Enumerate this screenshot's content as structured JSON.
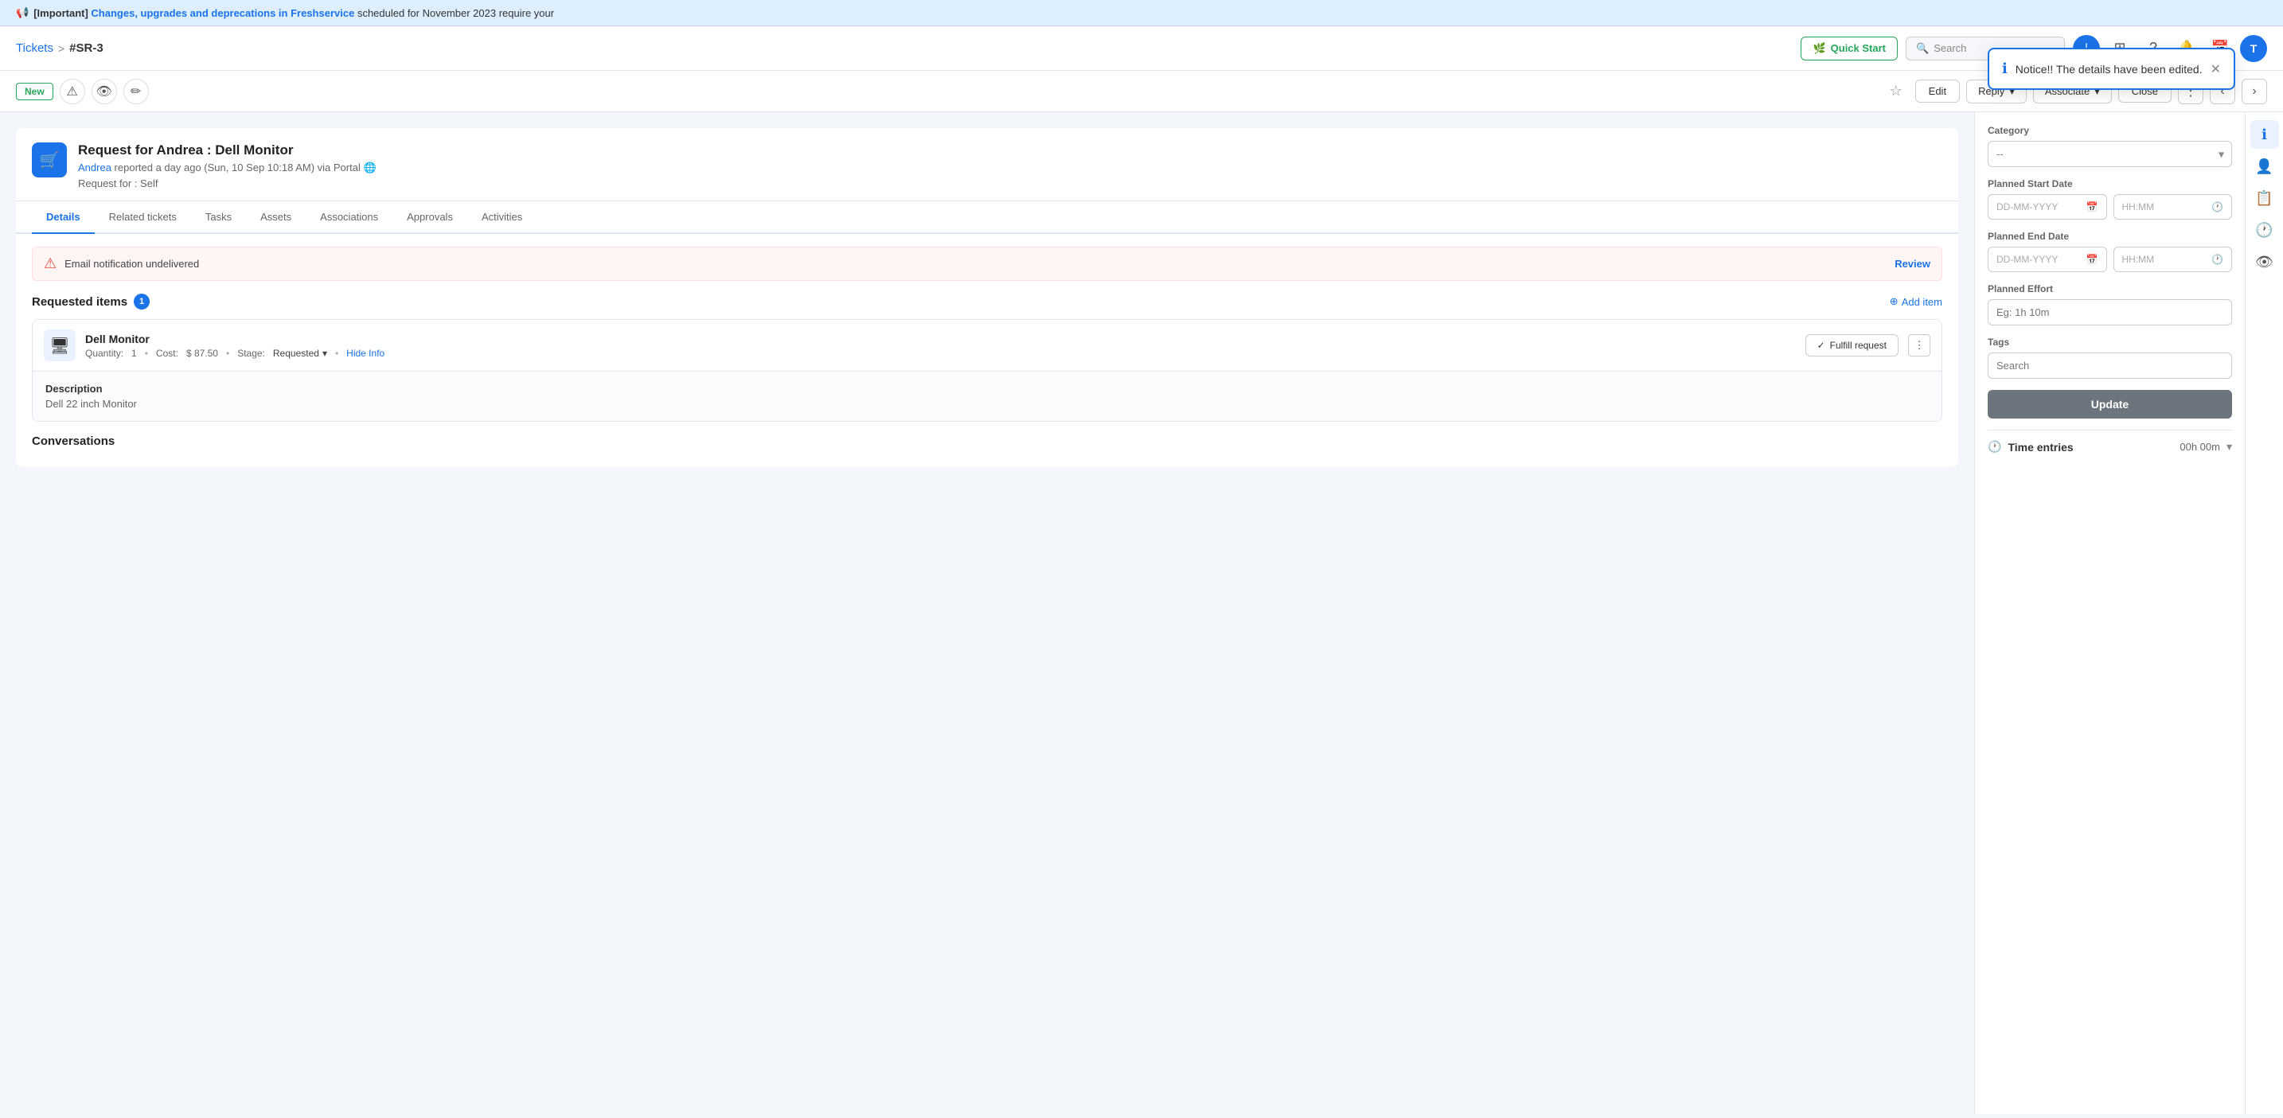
{
  "announcement": {
    "icon": "📢",
    "prefix": "[Important]",
    "link_text": "Changes, upgrades and deprecations in Freshservice",
    "suffix": "scheduled for November 2023 require your"
  },
  "breadcrumb": {
    "tickets": "Tickets",
    "separator": ">",
    "ticket_id": "#SR-3"
  },
  "header": {
    "quick_start": "Quick Start",
    "search_placeholder": "Search"
  },
  "toolbar": {
    "new_label": "New",
    "edit_label": "Edit",
    "reply_label": "Reply",
    "associate_label": "Associate",
    "close_label": "Close"
  },
  "ticket": {
    "title": "Request for Andrea : Dell Monitor",
    "reporter": "Andrea",
    "reported_time": "reported a day ago (Sun, 10 Sep 10:18 AM) via Portal",
    "request_for": "Request for :  Self"
  },
  "tabs": [
    {
      "id": "details",
      "label": "Details",
      "active": true
    },
    {
      "id": "related-tickets",
      "label": "Related tickets",
      "active": false
    },
    {
      "id": "tasks",
      "label": "Tasks",
      "active": false
    },
    {
      "id": "assets",
      "label": "Assets",
      "active": false
    },
    {
      "id": "associations",
      "label": "Associations",
      "active": false
    },
    {
      "id": "approvals",
      "label": "Approvals",
      "active": false
    },
    {
      "id": "activities",
      "label": "Activities",
      "active": false
    }
  ],
  "alert": {
    "message": "Email notification undelivered",
    "action": "Review"
  },
  "requested_items": {
    "title": "Requested items",
    "count": "1",
    "add_item": "Add item",
    "item": {
      "name": "Dell Monitor",
      "quantity_label": "Quantity:",
      "quantity": "1",
      "cost_label": "Cost:",
      "cost": "$ 87.50",
      "stage_label": "Stage:",
      "stage": "Requested",
      "hide_info": "Hide Info",
      "fulfill_label": "Fulfill request",
      "description_label": "Description",
      "description_text": "Dell 22 inch Monitor"
    }
  },
  "conversations": {
    "title": "Conversations"
  },
  "right_panel": {
    "category_label": "Category",
    "category_placeholder": "--",
    "planned_start_label": "Planned Start Date",
    "date_placeholder": "DD-MM-YYYY",
    "time_placeholder": "HH:MM",
    "planned_end_label": "Planned End Date",
    "planned_effort_label": "Planned Effort",
    "effort_placeholder": "Eg: 1h 10m",
    "tags_label": "Tags",
    "tags_placeholder": "Search",
    "update_label": "Update",
    "time_entries_label": "Time entries",
    "time_entries_value": "00h 00m"
  },
  "notification": {
    "text": "Notice!! The details have been edited."
  }
}
